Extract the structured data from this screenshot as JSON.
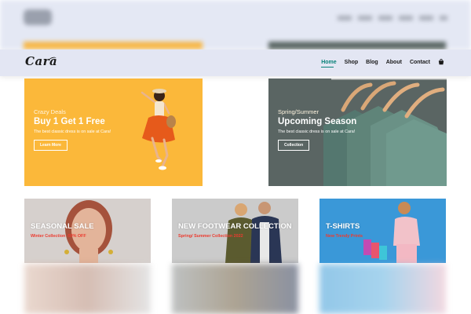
{
  "brand": {
    "logo_text": "Cara"
  },
  "nav": {
    "items": [
      {
        "label": "Home",
        "active": true
      },
      {
        "label": "Shop",
        "active": false
      },
      {
        "label": "Blog",
        "active": false
      },
      {
        "label": "About",
        "active": false
      },
      {
        "label": "Contact",
        "active": false
      }
    ],
    "cart_icon": "bag-icon"
  },
  "banners": {
    "deals": {
      "kicker": "Crazy Deals",
      "title": "Buy 1 Get 1 Free",
      "description": "The best classic dress is on sale at Cara!",
      "button": "Learn More"
    },
    "season": {
      "kicker": "Spring/Summer",
      "title": "Upcoming Season",
      "description": "The best classic dress is on sale at Cara!",
      "button": "Collection"
    }
  },
  "small_banners": [
    {
      "title": "SEASONAL SALE",
      "subtitle": "Winter Collection -50% OFF"
    },
    {
      "title": "NEW FOOTWEAR COLLECTION",
      "subtitle": "Spring/ Summer Collection 2022"
    },
    {
      "title": "T-SHIRTS",
      "subtitle": "New Trendy Prints"
    }
  ],
  "colors": {
    "accent": "#088178",
    "header_bg": "#e3e6f3",
    "deal_bg": "#fbb83a",
    "season_bg": "#56615f",
    "sale_red": "#ec3b2f"
  }
}
